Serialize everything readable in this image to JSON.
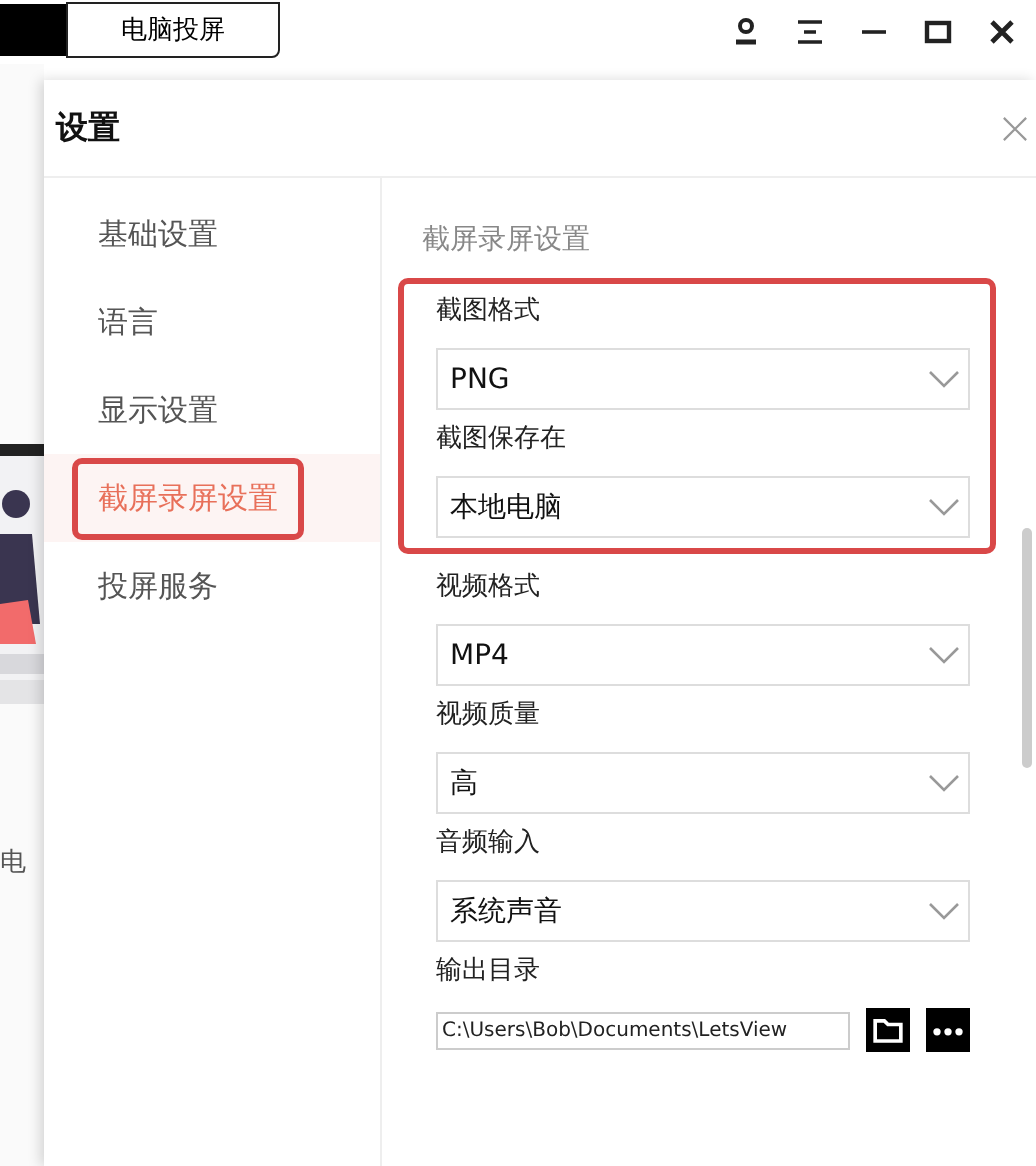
{
  "background_app": {
    "tab": "电脑投屏",
    "fragment_text": "电"
  },
  "settings": {
    "title": "设置",
    "nav": [
      {
        "label": "基础设置",
        "selected": false,
        "highlighted": false
      },
      {
        "label": "语言",
        "selected": false,
        "highlighted": false
      },
      {
        "label": "显示设置",
        "selected": false,
        "highlighted": false
      },
      {
        "label": "截屏录屏设置",
        "selected": true,
        "highlighted": true
      },
      {
        "label": "投屏服务",
        "selected": false,
        "highlighted": false
      }
    ],
    "section_title": "截屏录屏设置",
    "fields": [
      {
        "kind": "select",
        "label": "截图格式",
        "value": "PNG",
        "highlighted": true
      },
      {
        "kind": "select",
        "label": "截图保存在",
        "value": "本地电脑",
        "highlighted": true
      },
      {
        "kind": "select",
        "label": "视频格式",
        "value": "MP4"
      },
      {
        "kind": "select",
        "label": "视频质量",
        "value": "高"
      },
      {
        "kind": "select",
        "label": "音频输入",
        "value": "系统声音"
      },
      {
        "kind": "path",
        "label": "输出目录",
        "value": "C:\\Users\\Bob\\Documents\\LetsView"
      }
    ]
  }
}
